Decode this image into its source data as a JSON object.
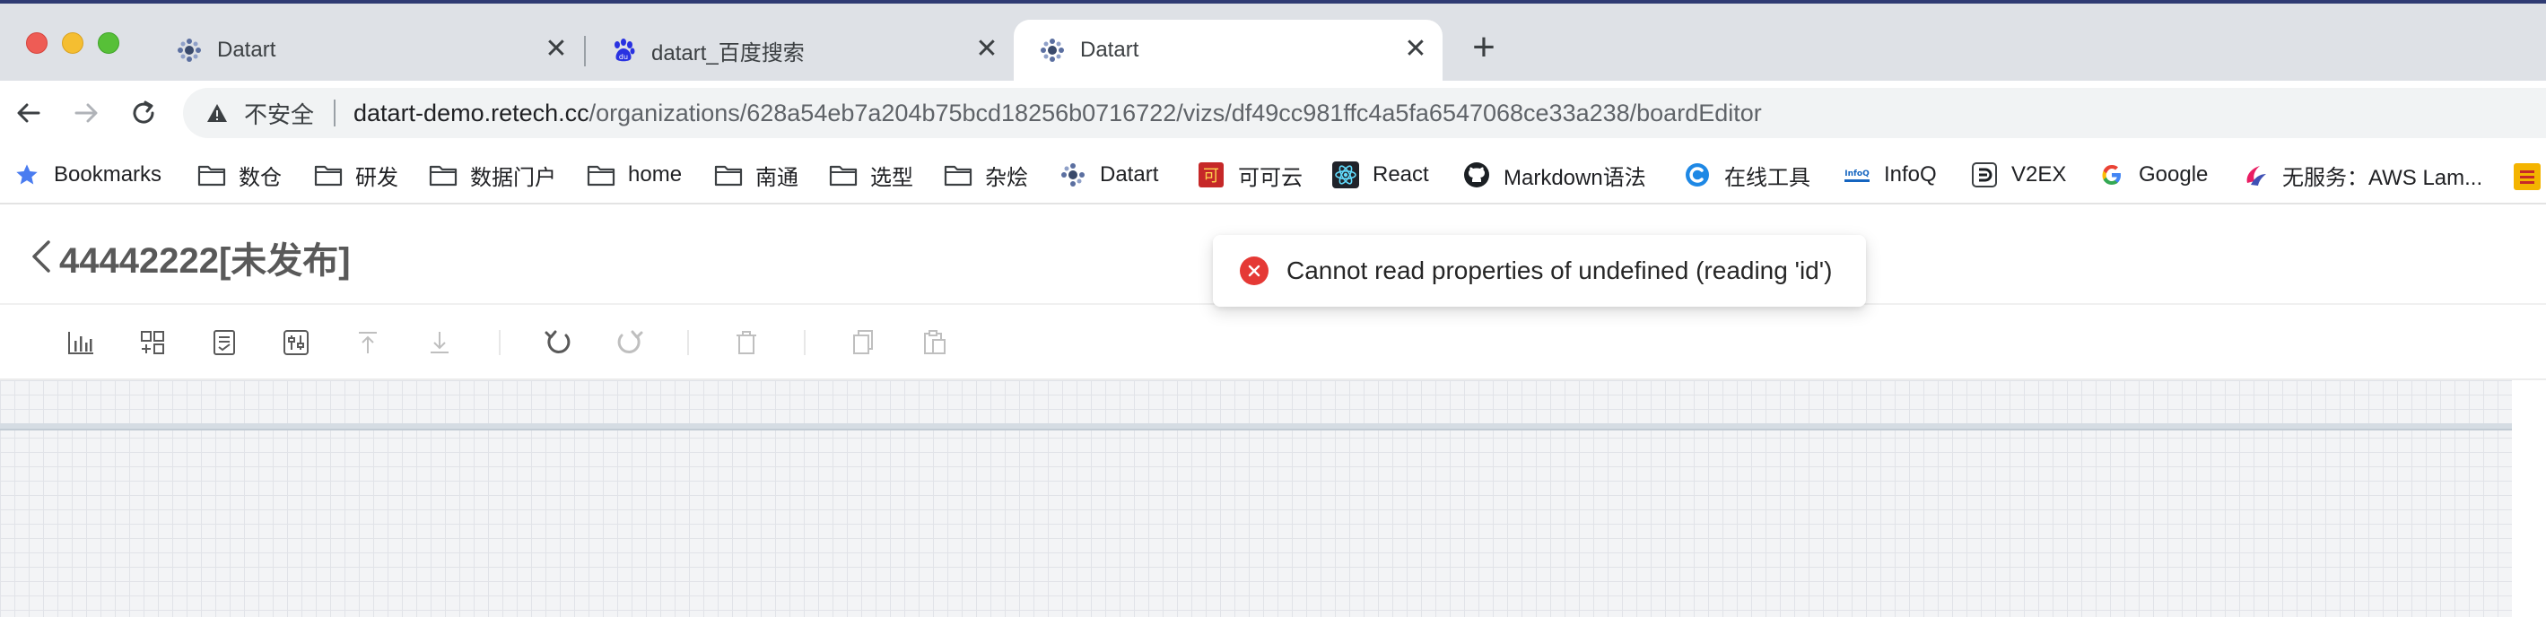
{
  "browser": {
    "tabs": [
      {
        "title": "Datart",
        "favicon": "datart-icon",
        "active": false
      },
      {
        "title": "datart_百度搜索",
        "favicon": "baidu-icon",
        "active": false
      },
      {
        "title": "Datart",
        "favicon": "datart-icon",
        "active": true
      }
    ],
    "new_tab_label": "+",
    "close_glyph": "✕",
    "omnibox": {
      "security_label": "不安全",
      "url_host": "datart-demo.retech.cc",
      "url_path": "/organizations/628a54eb7a204b75bcd18256b0716722/vizs/df49cc981ffc4a5fa6547068ce33a238/boardEditor"
    },
    "bookmarks": [
      {
        "label": "Bookmarks",
        "icon": "star-icon"
      },
      {
        "label": "数仓",
        "icon": "folder-icon"
      },
      {
        "label": "研发",
        "icon": "folder-icon"
      },
      {
        "label": "数据门户",
        "icon": "folder-icon"
      },
      {
        "label": "home",
        "icon": "folder-icon"
      },
      {
        "label": "南通",
        "icon": "folder-icon"
      },
      {
        "label": "选型",
        "icon": "folder-icon"
      },
      {
        "label": "杂烩",
        "icon": "folder-icon"
      },
      {
        "label": "Datart",
        "icon": "datart-icon"
      },
      {
        "label": "可可云",
        "icon": "kekeyun-icon"
      },
      {
        "label": "React",
        "icon": "react-icon"
      },
      {
        "label": "Markdown语法",
        "icon": "github-icon"
      },
      {
        "label": "在线工具",
        "icon": "tool-c-icon"
      },
      {
        "label": "InfoQ",
        "icon": "infoq-icon"
      },
      {
        "label": "V2EX",
        "icon": "v2ex-icon"
      },
      {
        "label": "Google",
        "icon": "google-icon"
      },
      {
        "label": "无服务：AWS Lam...",
        "icon": "serverless-icon"
      }
    ]
  },
  "app": {
    "board_title": "44442222[未发布]",
    "error_message": "Cannot read properties of undefined (reading 'id')",
    "toolbar_icons": [
      "chart-icon",
      "layout-add-icon",
      "media-widget-icon",
      "controller-icon",
      "bring-to-top-icon",
      "send-to-bottom-icon",
      "undo-icon",
      "redo-icon",
      "delete-icon",
      "copy-icon",
      "paste-icon"
    ]
  },
  "colors": {
    "tab_strip": "#dee1e6",
    "error": "#e53935",
    "title_text": "#595959",
    "canvas_bg": "#f3f4f6"
  }
}
